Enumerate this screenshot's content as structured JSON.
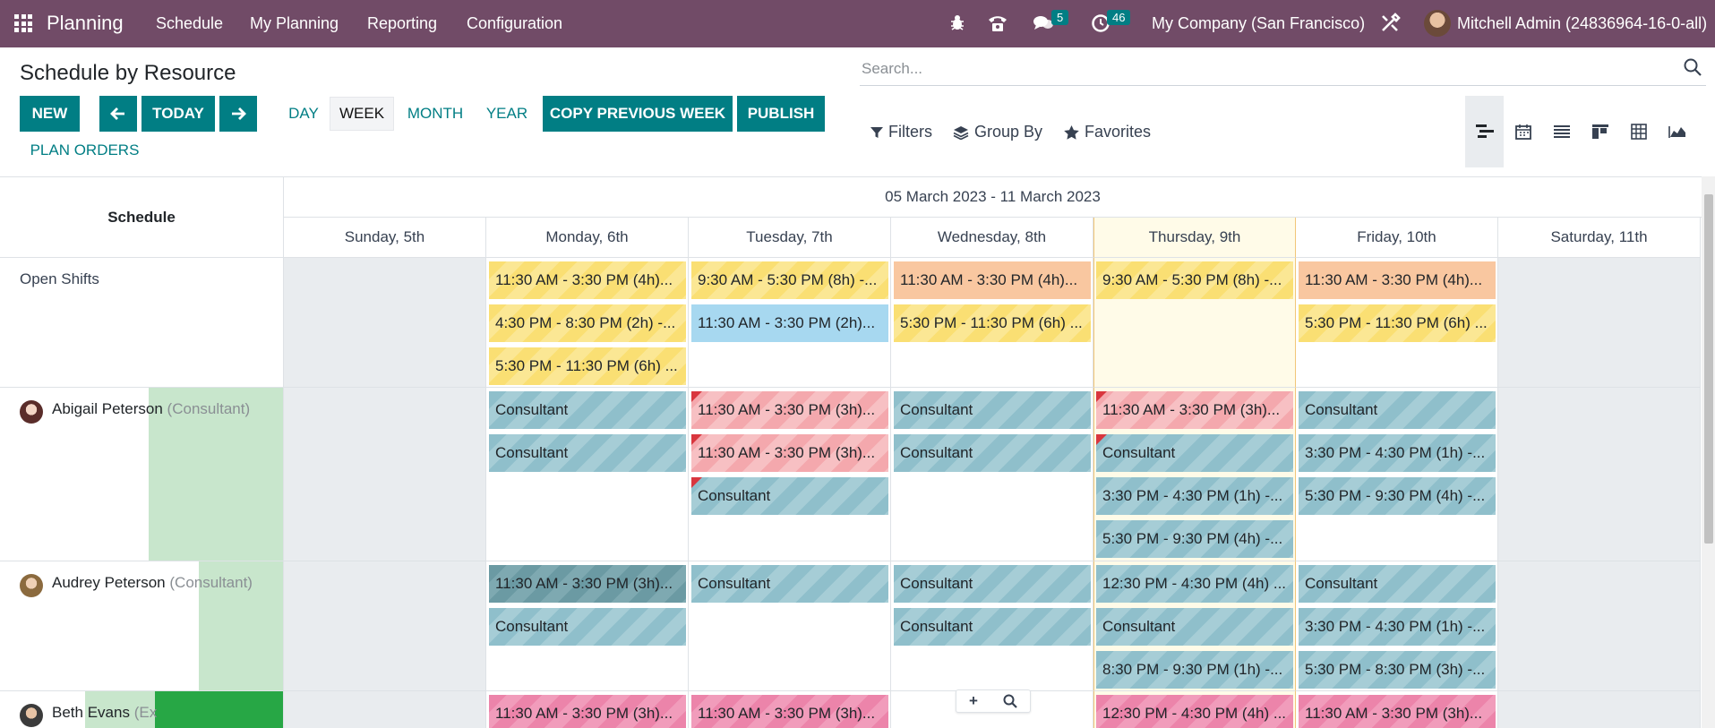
{
  "navbar": {
    "app_name": "Planning",
    "menu": [
      "Schedule",
      "My Planning",
      "Reporting",
      "Configuration"
    ],
    "messages_badge": "5",
    "activities_badge": "46",
    "company": "My Company (San Francisco)",
    "user": "Mitchell Admin (24836964-16-0-all)"
  },
  "control": {
    "title": "Schedule by Resource",
    "new": "NEW",
    "today": "TODAY",
    "scales": [
      "DAY",
      "WEEK",
      "MONTH",
      "YEAR"
    ],
    "active_scale": "WEEK",
    "copy_previous": "COPY PREVIOUS WEEK",
    "publish": "PUBLISH",
    "plan_orders": "PLAN ORDERS",
    "search_placeholder": "Search...",
    "filters": "Filters",
    "group_by": "Group By",
    "favorites": "Favorites"
  },
  "gantt": {
    "header_label": "Schedule",
    "range": "05 March 2023 - 11 March 2023",
    "days": [
      "Sunday, 5th",
      "Monday, 6th",
      "Tuesday, 7th",
      "Wednesday, 8th",
      "Thursday, 9th",
      "Friday, 10th",
      "Saturday, 11th"
    ],
    "today_index": 4,
    "rows": [
      {
        "name": "Open Shifts",
        "role": "",
        "shifts": [
          {
            "day": 1,
            "slot": 0,
            "text": "11:30 AM - 3:30 PM (4h)...",
            "color": "yellow"
          },
          {
            "day": 1,
            "slot": 1,
            "text": "4:30 PM - 8:30 PM (2h) -...",
            "color": "yellow"
          },
          {
            "day": 1,
            "slot": 2,
            "text": "5:30 PM - 11:30 PM (6h) ...",
            "color": "yellow"
          },
          {
            "day": 2,
            "slot": 0,
            "text": "9:30 AM - 5:30 PM (8h) -...",
            "color": "yellow"
          },
          {
            "day": 2,
            "slot": 1,
            "text": "11:30 AM - 3:30 PM (2h)...",
            "color": "blue"
          },
          {
            "day": 3,
            "slot": 0,
            "text": "11:30 AM - 3:30 PM (4h)...",
            "color": "orange"
          },
          {
            "day": 3,
            "slot": 1,
            "text": "5:30 PM - 11:30 PM (6h) ...",
            "color": "yellow"
          },
          {
            "day": 4,
            "slot": 0,
            "text": "9:30 AM - 5:30 PM (8h) -...",
            "color": "yellow"
          },
          {
            "day": 5,
            "slot": 0,
            "text": "11:30 AM - 3:30 PM (4h)...",
            "color": "orange"
          },
          {
            "day": 5,
            "slot": 1,
            "text": "5:30 PM - 11:30 PM (6h) ...",
            "color": "yellow"
          }
        ]
      },
      {
        "name": "Abigail Peterson",
        "role": "(Consultant)",
        "shifts": [
          {
            "day": 1,
            "slot": 0,
            "text": "Consultant",
            "color": "teal"
          },
          {
            "day": 1,
            "slot": 1,
            "text": "Consultant",
            "color": "teal"
          },
          {
            "day": 2,
            "slot": 0,
            "text": "11:30 AM - 3:30 PM (3h)...",
            "color": "red",
            "flag": true
          },
          {
            "day": 2,
            "slot": 1,
            "text": "11:30 AM - 3:30 PM (3h)...",
            "color": "red",
            "flag": true
          },
          {
            "day": 2,
            "slot": 2,
            "text": "Consultant",
            "color": "teal",
            "flag": true
          },
          {
            "day": 3,
            "slot": 0,
            "text": "Consultant",
            "color": "teal"
          },
          {
            "day": 3,
            "slot": 1,
            "text": "Consultant",
            "color": "teal"
          },
          {
            "day": 4,
            "slot": 0,
            "text": "11:30 AM - 3:30 PM (3h)...",
            "color": "red",
            "flag": true
          },
          {
            "day": 4,
            "slot": 1,
            "text": "Consultant",
            "color": "teal",
            "flag": true
          },
          {
            "day": 4,
            "slot": 2,
            "text": "3:30 PM - 4:30 PM (1h) -...",
            "color": "teal"
          },
          {
            "day": 4,
            "slot": 3,
            "text": "5:30 PM - 9:30 PM (4h) -...",
            "color": "teal"
          },
          {
            "day": 5,
            "slot": 0,
            "text": "Consultant",
            "color": "teal"
          },
          {
            "day": 5,
            "slot": 1,
            "text": "3:30 PM - 4:30 PM (1h) -...",
            "color": "teal"
          },
          {
            "day": 5,
            "slot": 2,
            "text": "5:30 PM - 9:30 PM (4h) -...",
            "color": "teal"
          }
        ]
      },
      {
        "name": "Audrey Peterson",
        "role": "(Consultant)",
        "shifts": [
          {
            "day": 1,
            "slot": 0,
            "text": "11:30 AM - 3:30 PM (3h)...",
            "color": "darkteal"
          },
          {
            "day": 1,
            "slot": 1,
            "text": "Consultant",
            "color": "teal"
          },
          {
            "day": 2,
            "slot": 0,
            "text": "Consultant",
            "color": "teal"
          },
          {
            "day": 3,
            "slot": 0,
            "text": "Consultant",
            "color": "teal"
          },
          {
            "day": 3,
            "slot": 1,
            "text": "Consultant",
            "color": "teal"
          },
          {
            "day": 4,
            "slot": 0,
            "text": "12:30 PM - 4:30 PM (4h) ...",
            "color": "teal"
          },
          {
            "day": 4,
            "slot": 1,
            "text": "Consultant",
            "color": "teal"
          },
          {
            "day": 4,
            "slot": 2,
            "text": "8:30 PM - 9:30 PM (1h) -...",
            "color": "teal"
          },
          {
            "day": 5,
            "slot": 0,
            "text": "Consultant",
            "color": "teal"
          },
          {
            "day": 5,
            "slot": 1,
            "text": "3:30 PM - 4:30 PM (1h) -...",
            "color": "teal"
          },
          {
            "day": 5,
            "slot": 2,
            "text": "5:30 PM - 8:30 PM (3h) -...",
            "color": "teal"
          }
        ]
      },
      {
        "name": "Beth Evans",
        "role": "(Ex",
        "shifts": [
          {
            "day": 1,
            "slot": 0,
            "text": "11:30 AM - 3:30 PM (3h)...",
            "color": "pink"
          },
          {
            "day": 2,
            "slot": 0,
            "text": "11:30 AM - 3:30 PM (3h)...",
            "color": "pink"
          },
          {
            "day": 4,
            "slot": 0,
            "text": "12:30 PM - 4:30 PM (4h) ...",
            "color": "pink"
          },
          {
            "day": 5,
            "slot": 0,
            "text": "11:30 AM - 3:30 PM (3h)...",
            "color": "pink"
          }
        ]
      }
    ]
  },
  "row_tools": {
    "add": "+",
    "zoom": "⚲"
  }
}
